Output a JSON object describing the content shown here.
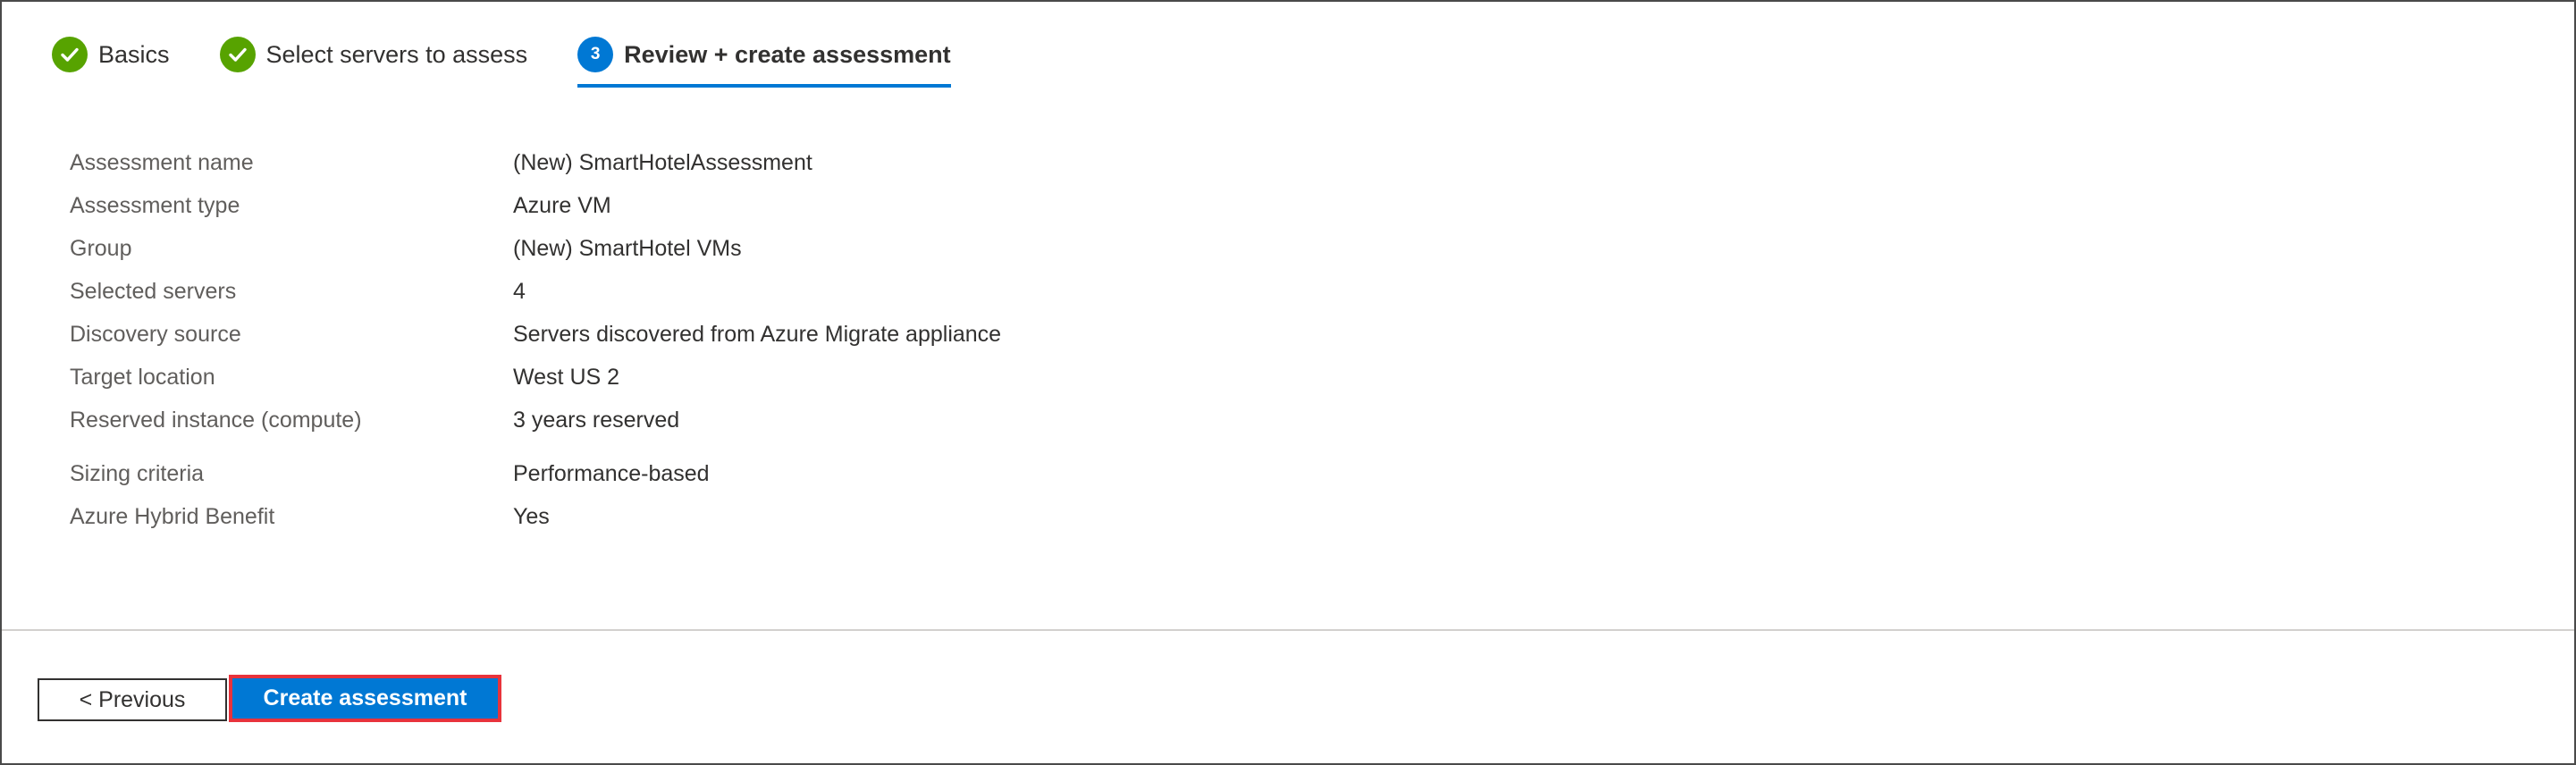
{
  "steps": [
    {
      "label": "Basics",
      "state": "done"
    },
    {
      "label": "Select servers to assess",
      "state": "done"
    },
    {
      "label": "Review + create assessment",
      "state": "current",
      "number": "3"
    }
  ],
  "summary": {
    "rows": [
      {
        "label": "Assessment name",
        "value": "(New) SmartHotelAssessment"
      },
      {
        "label": "Assessment type",
        "value": "Azure VM"
      },
      {
        "label": "Group",
        "value": "(New) SmartHotel VMs"
      },
      {
        "label": "Selected servers",
        "value": "4"
      },
      {
        "label": "Discovery source",
        "value": "Servers discovered from Azure Migrate appliance"
      },
      {
        "label": "Target location",
        "value": "West US 2"
      },
      {
        "label": "Reserved instance (compute)",
        "value": "3 years reserved"
      },
      {
        "label": "Sizing criteria",
        "value": "Performance-based"
      },
      {
        "label": "Azure Hybrid Benefit",
        "value": "Yes"
      }
    ]
  },
  "footer": {
    "previous_label": "< Previous",
    "create_label": "Create assessment"
  },
  "colors": {
    "accent": "#0078d4",
    "success": "#57a300",
    "highlight": "#e8333c"
  }
}
